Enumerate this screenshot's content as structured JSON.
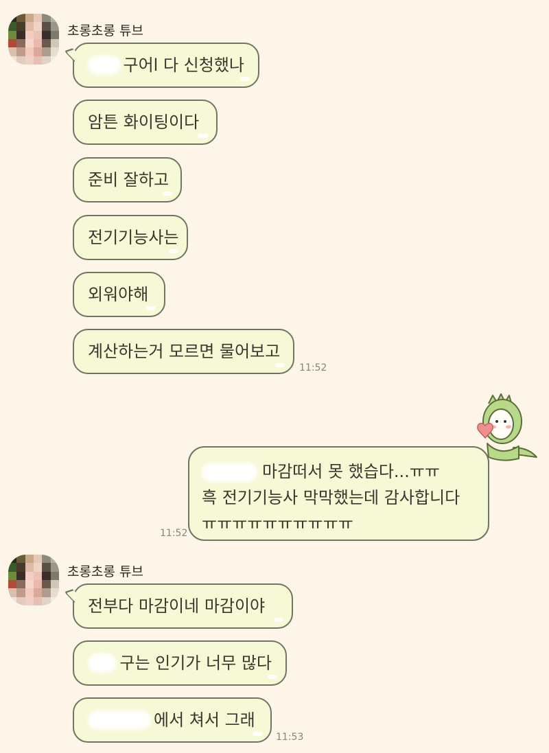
{
  "colors": {
    "background": "#fcf5e8",
    "bubble_fill": "#f6f8d6",
    "bubble_border": "#6e7562",
    "timestamp": "#8a8377"
  },
  "avatar_icon": "pixelated-profile-photo",
  "sticker_icon": "green-dinosaur-holding-heart",
  "group1": {
    "sender": "초롱초롱 튜브",
    "messages": [
      "구어l 다 신청했나",
      "암튼 화이팅이다",
      "준비 잘하고",
      "전기기능사는",
      "외워야해",
      "계산하는거 모르면 물어보고"
    ],
    "time": "11:52"
  },
  "mine": {
    "lines": [
      "마감떠서 못 했습다...ㅠㅠ",
      "흑 전기기능사 막막했는데 감사합니다",
      "ㅠㅠㅠㅠㅠㅠㅠㅠㅠㅠ"
    ],
    "time": "11:52"
  },
  "group2": {
    "sender": "초롱초롱 튜브",
    "messages": [
      "전부다 마감이네 마감이야",
      "구는 인기가 너무 많다",
      "에서 쳐서 그래"
    ],
    "time": "11:53"
  }
}
